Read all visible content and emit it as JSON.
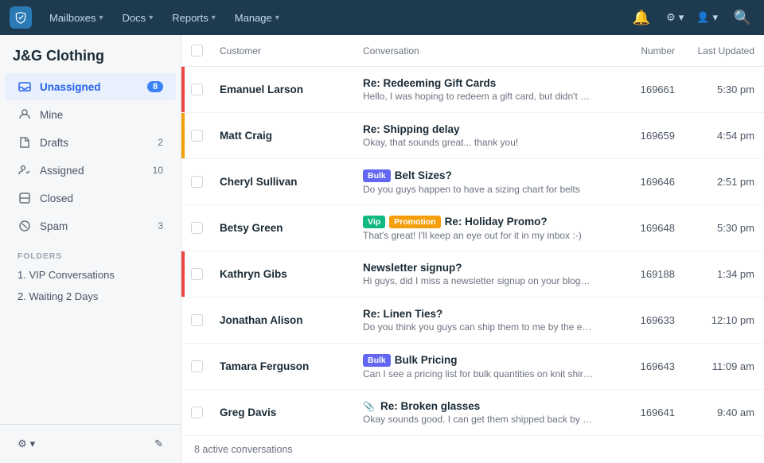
{
  "topnav": {
    "logo_symbol": "✦",
    "items": [
      {
        "label": "Mailboxes",
        "has_chevron": true
      },
      {
        "label": "Docs",
        "has_chevron": true
      },
      {
        "label": "Reports",
        "has_chevron": true
      },
      {
        "label": "Manage",
        "has_chevron": true
      }
    ],
    "icons": {
      "bell": "🔔",
      "settings": "⚙",
      "avatar": "👤",
      "search": "🔍"
    }
  },
  "sidebar": {
    "company": "J&G Clothing",
    "nav_items": [
      {
        "id": "unassigned",
        "icon": "inbox",
        "label": "Unassigned",
        "badge": "8",
        "active": true
      },
      {
        "id": "mine",
        "icon": "person",
        "label": "Mine",
        "badge": "",
        "active": false
      },
      {
        "id": "drafts",
        "icon": "draft",
        "label": "Drafts",
        "count": "2",
        "active": false
      },
      {
        "id": "assigned",
        "icon": "assign",
        "label": "Assigned",
        "count": "10",
        "active": false
      },
      {
        "id": "closed",
        "icon": "closed",
        "label": "Closed",
        "count": "",
        "active": false
      },
      {
        "id": "spam",
        "icon": "spam",
        "label": "Spam",
        "count": "3",
        "active": false
      }
    ],
    "folders_label": "FOLDERS",
    "folders": [
      {
        "label": "1. VIP Conversations"
      },
      {
        "label": "2. Waiting 2 Days"
      }
    ],
    "footer": {
      "settings_label": "⚙ ▾",
      "compose_label": "✎"
    }
  },
  "table": {
    "headers": {
      "customer": "Customer",
      "conversation": "Conversation",
      "number": "Number",
      "last_updated": "Last Updated"
    },
    "rows": [
      {
        "id": 1,
        "priority": "red",
        "customer": "Emanuel Larson",
        "title": "Re: Redeeming Gift Cards",
        "preview": "Hello, I was hoping to redeem a gift card, but didn't see a price",
        "number": "169661",
        "updated": "5:30 pm",
        "tags": [],
        "has_attachment": false
      },
      {
        "id": 2,
        "priority": "orange",
        "customer": "Matt Craig",
        "title": "Re: Shipping delay",
        "preview": "Okay, that sounds great... thank you!",
        "number": "169659",
        "updated": "4:54 pm",
        "tags": [],
        "has_attachment": false
      },
      {
        "id": 3,
        "priority": "",
        "customer": "Cheryl Sullivan",
        "title": "Belt Sizes?",
        "preview": "Do you guys happen to have a sizing chart for belts",
        "number": "169646",
        "updated": "2:51 pm",
        "tags": [
          {
            "type": "bulk",
            "label": "Bulk"
          }
        ],
        "has_attachment": false
      },
      {
        "id": 4,
        "priority": "",
        "customer": "Betsy Green",
        "title": "Re: Holiday Promo?",
        "preview": "That's great! I'll keep an eye out for it in my inbox :-)",
        "number": "169648",
        "updated": "5:30 pm",
        "tags": [
          {
            "type": "vip",
            "label": "Vip"
          },
          {
            "type": "promo",
            "label": "Promotion"
          }
        ],
        "has_attachment": false
      },
      {
        "id": 5,
        "priority": "red",
        "customer": "Kathryn Gibs",
        "title": "Newsletter signup?",
        "preview": "Hi guys, did I miss a newsletter signup on your blog? I'd love",
        "number": "169188",
        "updated": "1:34 pm",
        "tags": [],
        "has_attachment": false
      },
      {
        "id": 6,
        "priority": "",
        "customer": "Jonathan Alison",
        "title": "Re: Linen Ties?",
        "preview": "Do you think you guys can ship them to me by the end of the wee",
        "number": "169633",
        "updated": "12:10 pm",
        "tags": [],
        "has_attachment": false
      },
      {
        "id": 7,
        "priority": "",
        "customer": "Tamara Ferguson",
        "title": "Bulk Pricing",
        "preview": "Can I see a pricing list for bulk quantities on knit shirts?",
        "number": "169643",
        "updated": "11:09 am",
        "tags": [
          {
            "type": "bulk",
            "label": "Bulk"
          }
        ],
        "has_attachment": false
      },
      {
        "id": 8,
        "priority": "",
        "customer": "Greg Davis",
        "title": "Re: Broken glasses",
        "preview": "Okay sounds good. I can get them shipped back by friday",
        "number": "169641",
        "updated": "9:40 am",
        "tags": [],
        "has_attachment": true
      }
    ],
    "footer_text": "8 active conversations"
  }
}
